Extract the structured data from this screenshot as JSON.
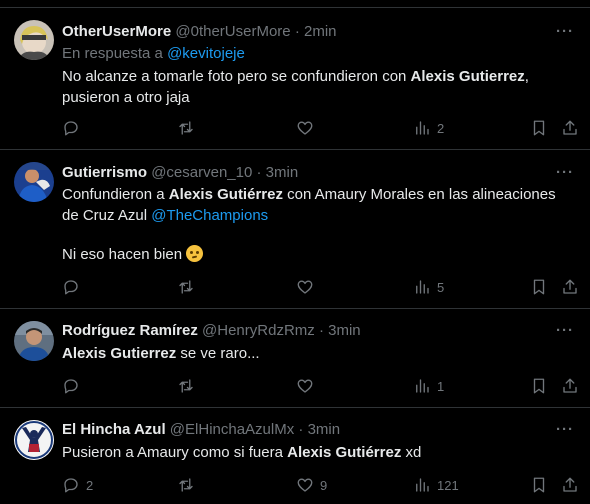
{
  "more_label": "···",
  "tweets": [
    {
      "name": "OtherUserMore",
      "handle": "@0therUserMore",
      "separator": "·",
      "time": "2min",
      "reply_prefix": "En respuesta a ",
      "reply_to": "@kevitojeje",
      "text_1": "No alcanze a tomarle foto pero se confundieron con ",
      "bold_1": "Alexis Gutierrez",
      "text_2": ",",
      "text_3": "pusieron a otro jaja",
      "replies": "",
      "retweets": "",
      "likes": "",
      "views": "2"
    },
    {
      "name": "Gutierrismo",
      "handle": "@cesarven_10",
      "separator": "·",
      "time": "3min",
      "text_1": "Confundieron a ",
      "bold_1": "Alexis Gutiérrez",
      "text_2": " con Amaury Morales en las alineaciones",
      "text_3": "de Cruz Azul ",
      "mention": "@TheChampions",
      "text_4": "Ni eso hacen bien ",
      "emoji": "thinking-face-emoji",
      "replies": "",
      "retweets": "",
      "likes": "",
      "views": "5"
    },
    {
      "name": "Rodríguez Ramírez",
      "handle": "@HenryRdzRmz",
      "separator": "·",
      "time": "3min",
      "bold_1": "Alexis Gutierrez",
      "text_1": " se ve raro...",
      "replies": "",
      "retweets": "",
      "likes": "",
      "views": "1"
    },
    {
      "name": "El Hincha Azul",
      "handle": "@ElHinchaAzulMx",
      "separator": "·",
      "time": "3min",
      "text_1": "Pusieron a Amaury como si fuera ",
      "bold_1": "Alexis Gutiérrez",
      "text_2": " xd",
      "replies": "2",
      "retweets": "",
      "likes": "9",
      "views": "121"
    }
  ]
}
